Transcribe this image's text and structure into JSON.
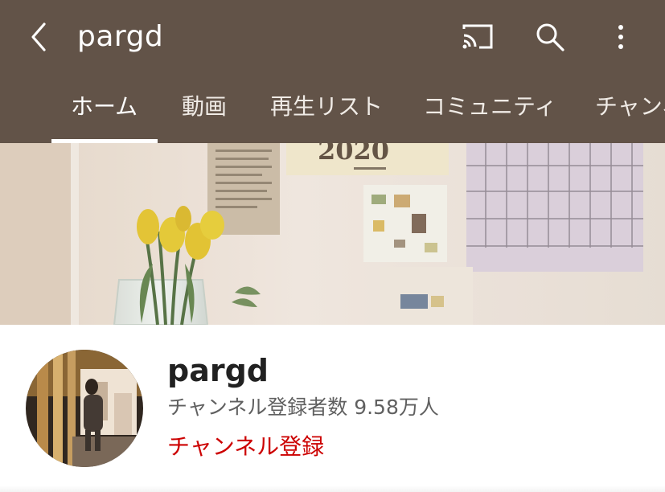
{
  "header": {
    "title": "pargd",
    "back_icon": "chevron-left-icon",
    "cast_icon": "cast-icon",
    "search_icon": "search-icon",
    "more_icon": "more-vertical-icon"
  },
  "tabs": [
    {
      "label": "ホーム",
      "active": true
    },
    {
      "label": "動画",
      "active": false
    },
    {
      "label": "再生リスト",
      "active": false
    },
    {
      "label": "コミュニティ",
      "active": false
    },
    {
      "label": "チャンネ",
      "active": false
    }
  ],
  "banner": {
    "calendar_year": "2020"
  },
  "channel": {
    "name": "pargd",
    "subscriber_text": "チャンネル登録者数 9.58万人",
    "subscribe_label": "チャンネル登録"
  },
  "colors": {
    "header_bg": "#625348",
    "subscribe_red": "#cc0000"
  }
}
